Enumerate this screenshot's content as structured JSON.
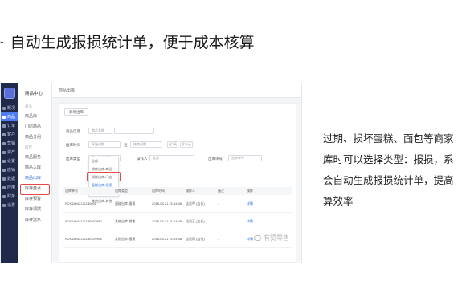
{
  "slide": {
    "title": "自动生成报损统计单，便于成本核算",
    "bullet": "-",
    "description": [
      "过期、损坏蛋糕、面包等商家",
      "库时可以选择类型：报损，系",
      "会自动生成报损统计单，提高",
      "算效率"
    ]
  },
  "app": {
    "sidebar": [
      {
        "label": "概况",
        "icon": "home-icon"
      },
      {
        "label": "商品",
        "icon": "goods-icon",
        "active": true
      },
      {
        "label": "订单",
        "icon": "order-icon"
      },
      {
        "label": "客户",
        "icon": "customer-icon"
      },
      {
        "label": "营销",
        "icon": "marketing-icon"
      },
      {
        "label": "资产",
        "icon": "asset-icon"
      },
      {
        "label": "设置",
        "icon": "gear-icon"
      },
      {
        "label": "店铺",
        "icon": "store-icon"
      },
      {
        "label": "数据",
        "icon": "chart-icon"
      },
      {
        "label": "应用",
        "icon": "apps-icon"
      },
      {
        "label": "财务",
        "icon": "finance-icon"
      },
      {
        "label": "设置",
        "icon": "settings-icon"
      }
    ],
    "submenu": {
      "title": "商品中心",
      "items": [
        "商品库",
        "门店商品",
        "商品分组",
        "商品服务",
        "商品入库",
        "商品出库",
        "库存盘点",
        "库存预警",
        "库存调拨",
        "库存流水"
      ]
    },
    "page": {
      "breadcrumb": "商品出库",
      "add_button": "新增出库",
      "form": {
        "product_label": "商品信息",
        "product_select": "商品名称",
        "time_label": "出库时间",
        "start_placeholder": "开始日期",
        "end_placeholder": "结束日期",
        "to": "至",
        "type_label": "出库类型",
        "type_select": "所有出库类型",
        "operator_label": "操作人",
        "operator_value": "全部",
        "order_label": "出库单号",
        "order_placeholder": "出库单号",
        "quick_days": [
          "近7天",
          "近30天"
        ]
      },
      "dropdown": [
        "全部",
        "销售出库-商品",
        "调拨出库-门店",
        "蛋糕出库-报损",
        "其他出库-销售",
        "其他出库-其他"
      ],
      "table": {
        "headers": [
          "出库单号",
          "出库类型",
          "出库时间",
          "操作人",
          "备注",
          "操作"
        ],
        "rows": [
          [
            "SCK18042121130000",
            "蛋糕出库-报损",
            "2018-04-21 21:14:46",
            "店员甲 (店长)",
            "-",
            "详情"
          ],
          [
            "SCK18042121130032680",
            "其他出库-销售",
            "2018-04-21 21:14:48",
            "店员乙 (店长)",
            "-",
            "详情"
          ],
          [
            "SCK18042121130429956",
            "其他出库-报损",
            "2018-04-21 21:14:48",
            "店员丙 (店长)",
            "-",
            "详情"
          ]
        ]
      }
    }
  },
  "watermark": "有赞零售"
}
